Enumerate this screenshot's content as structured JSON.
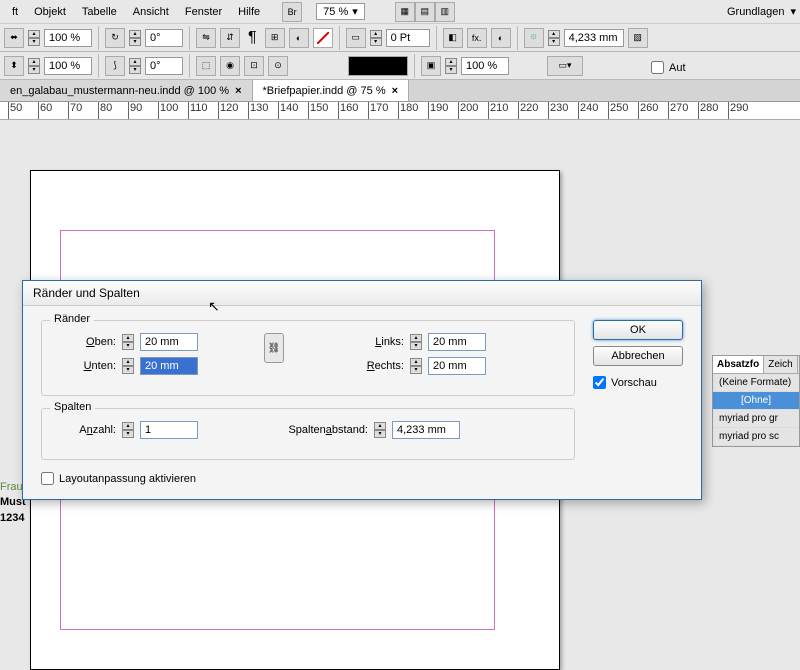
{
  "menu": {
    "items": [
      "ft",
      "Objekt",
      "Tabelle",
      "Ansicht",
      "Fenster",
      "Hilfe"
    ],
    "br": "Br",
    "zoom": "75 %",
    "workspace": "Grundlagen"
  },
  "toolbar1": {
    "pct1": "100 %",
    "pct2": "100 %",
    "ang1": "0°",
    "ang2": "0°",
    "pt": "0 Pt",
    "mm": "4,233 mm",
    "hundred": "100 %",
    "aut": "Aut"
  },
  "tabs": [
    {
      "label": "en_galabau_mustermann-neu.indd @ 100 %",
      "active": false
    },
    {
      "label": "*Briefpapier.indd @ 75 %",
      "active": true
    }
  ],
  "ruler": [
    "50",
    "60",
    "70",
    "80",
    "90",
    "100",
    "110",
    "120",
    "130",
    "140",
    "150",
    "160",
    "170",
    "180",
    "190",
    "200",
    "210",
    "220",
    "230",
    "240",
    "250",
    "260",
    "270",
    "280",
    "290"
  ],
  "sideText": {
    "frau": "Frau",
    "must": "Must",
    "num": "1234"
  },
  "panel": {
    "t1": "Absatzfo",
    "t2": "Zeich",
    "none": "(Keine Formate)",
    "ohne": "[Ohne]",
    "r1": "myriad pro gr",
    "r2": "myriad pro sc"
  },
  "dialog": {
    "title": "Ränder und Spalten",
    "margins": {
      "title": "Ränder",
      "oben": "Oben:",
      "unten": "Unten:",
      "links": "Links:",
      "rechts": "Rechts:",
      "v_oben": "20 mm",
      "v_unten": "20 mm",
      "v_links": "20 mm",
      "v_rechts": "20 mm"
    },
    "cols": {
      "title": "Spalten",
      "anzahl": "Anzahl:",
      "v_anzahl": "1",
      "abstand": "Spaltenabstand:",
      "v_abstand": "4,233 mm"
    },
    "layout": "Layoutanpassung aktivieren",
    "ok": "OK",
    "cancel": "Abbrechen",
    "preview": "Vorschau"
  }
}
